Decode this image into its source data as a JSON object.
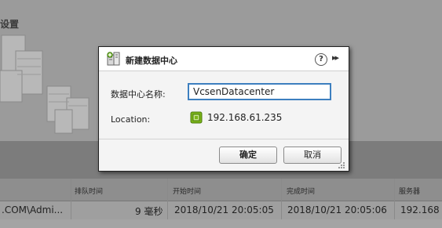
{
  "background": {
    "heading": "设置",
    "table": {
      "columns": [
        "排队时间",
        "开始时间",
        "完成时间",
        "服务器"
      ],
      "row": {
        "user": ".COM\\Admi...",
        "queued": "9 毫秒",
        "start": "2018/10/21 20:05:05",
        "end": "2018/10/21 20:05:06",
        "server": "192.168"
      }
    }
  },
  "dialog": {
    "title": "新建数据中心",
    "help_label": "?",
    "more_label": "▸▸",
    "name_label": "数据中心名称:",
    "name_value": "VcsenDatacenter",
    "location_label": "Location:",
    "location_value": "192.168.61.235",
    "ok_label": "确定",
    "cancel_label": "取消"
  },
  "colors": {
    "input_focus_border": "#3d7fbf",
    "host_icon": "#7cb518"
  }
}
